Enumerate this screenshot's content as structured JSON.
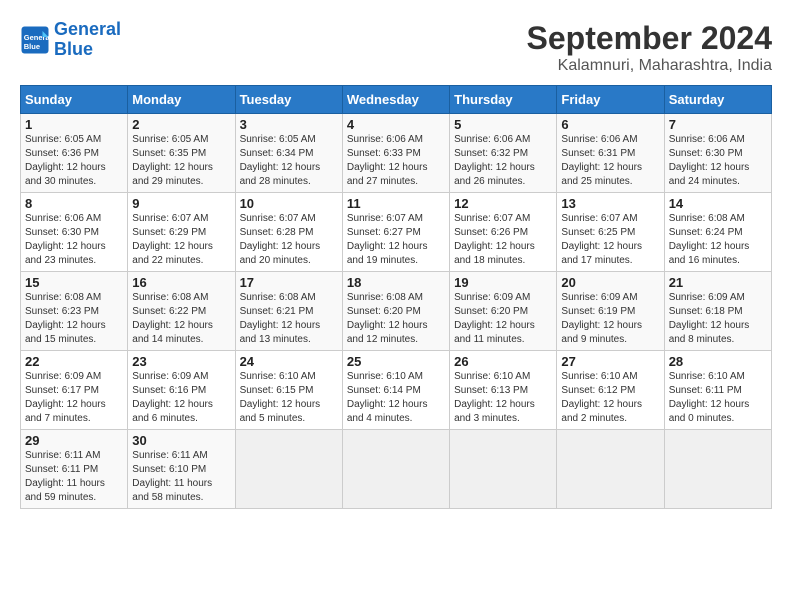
{
  "header": {
    "logo_line1": "General",
    "logo_line2": "Blue",
    "title": "September 2024",
    "subtitle": "Kalamnuri, Maharashtra, India"
  },
  "weekdays": [
    "Sunday",
    "Monday",
    "Tuesday",
    "Wednesday",
    "Thursday",
    "Friday",
    "Saturday"
  ],
  "weeks": [
    [
      {
        "day": "1",
        "info": "Sunrise: 6:05 AM\nSunset: 6:36 PM\nDaylight: 12 hours\nand 30 minutes."
      },
      {
        "day": "2",
        "info": "Sunrise: 6:05 AM\nSunset: 6:35 PM\nDaylight: 12 hours\nand 29 minutes."
      },
      {
        "day": "3",
        "info": "Sunrise: 6:05 AM\nSunset: 6:34 PM\nDaylight: 12 hours\nand 28 minutes."
      },
      {
        "day": "4",
        "info": "Sunrise: 6:06 AM\nSunset: 6:33 PM\nDaylight: 12 hours\nand 27 minutes."
      },
      {
        "day": "5",
        "info": "Sunrise: 6:06 AM\nSunset: 6:32 PM\nDaylight: 12 hours\nand 26 minutes."
      },
      {
        "day": "6",
        "info": "Sunrise: 6:06 AM\nSunset: 6:31 PM\nDaylight: 12 hours\nand 25 minutes."
      },
      {
        "day": "7",
        "info": "Sunrise: 6:06 AM\nSunset: 6:30 PM\nDaylight: 12 hours\nand 24 minutes."
      }
    ],
    [
      {
        "day": "8",
        "info": "Sunrise: 6:06 AM\nSunset: 6:30 PM\nDaylight: 12 hours\nand 23 minutes."
      },
      {
        "day": "9",
        "info": "Sunrise: 6:07 AM\nSunset: 6:29 PM\nDaylight: 12 hours\nand 22 minutes."
      },
      {
        "day": "10",
        "info": "Sunrise: 6:07 AM\nSunset: 6:28 PM\nDaylight: 12 hours\nand 20 minutes."
      },
      {
        "day": "11",
        "info": "Sunrise: 6:07 AM\nSunset: 6:27 PM\nDaylight: 12 hours\nand 19 minutes."
      },
      {
        "day": "12",
        "info": "Sunrise: 6:07 AM\nSunset: 6:26 PM\nDaylight: 12 hours\nand 18 minutes."
      },
      {
        "day": "13",
        "info": "Sunrise: 6:07 AM\nSunset: 6:25 PM\nDaylight: 12 hours\nand 17 minutes."
      },
      {
        "day": "14",
        "info": "Sunrise: 6:08 AM\nSunset: 6:24 PM\nDaylight: 12 hours\nand 16 minutes."
      }
    ],
    [
      {
        "day": "15",
        "info": "Sunrise: 6:08 AM\nSunset: 6:23 PM\nDaylight: 12 hours\nand 15 minutes."
      },
      {
        "day": "16",
        "info": "Sunrise: 6:08 AM\nSunset: 6:22 PM\nDaylight: 12 hours\nand 14 minutes."
      },
      {
        "day": "17",
        "info": "Sunrise: 6:08 AM\nSunset: 6:21 PM\nDaylight: 12 hours\nand 13 minutes."
      },
      {
        "day": "18",
        "info": "Sunrise: 6:08 AM\nSunset: 6:20 PM\nDaylight: 12 hours\nand 12 minutes."
      },
      {
        "day": "19",
        "info": "Sunrise: 6:09 AM\nSunset: 6:20 PM\nDaylight: 12 hours\nand 11 minutes."
      },
      {
        "day": "20",
        "info": "Sunrise: 6:09 AM\nSunset: 6:19 PM\nDaylight: 12 hours\nand 9 minutes."
      },
      {
        "day": "21",
        "info": "Sunrise: 6:09 AM\nSunset: 6:18 PM\nDaylight: 12 hours\nand 8 minutes."
      }
    ],
    [
      {
        "day": "22",
        "info": "Sunrise: 6:09 AM\nSunset: 6:17 PM\nDaylight: 12 hours\nand 7 minutes."
      },
      {
        "day": "23",
        "info": "Sunrise: 6:09 AM\nSunset: 6:16 PM\nDaylight: 12 hours\nand 6 minutes."
      },
      {
        "day": "24",
        "info": "Sunrise: 6:10 AM\nSunset: 6:15 PM\nDaylight: 12 hours\nand 5 minutes."
      },
      {
        "day": "25",
        "info": "Sunrise: 6:10 AM\nSunset: 6:14 PM\nDaylight: 12 hours\nand 4 minutes."
      },
      {
        "day": "26",
        "info": "Sunrise: 6:10 AM\nSunset: 6:13 PM\nDaylight: 12 hours\nand 3 minutes."
      },
      {
        "day": "27",
        "info": "Sunrise: 6:10 AM\nSunset: 6:12 PM\nDaylight: 12 hours\nand 2 minutes."
      },
      {
        "day": "28",
        "info": "Sunrise: 6:10 AM\nSunset: 6:11 PM\nDaylight: 12 hours\nand 0 minutes."
      }
    ],
    [
      {
        "day": "29",
        "info": "Sunrise: 6:11 AM\nSunset: 6:11 PM\nDaylight: 11 hours\nand 59 minutes."
      },
      {
        "day": "30",
        "info": "Sunrise: 6:11 AM\nSunset: 6:10 PM\nDaylight: 11 hours\nand 58 minutes."
      },
      {
        "day": "",
        "info": ""
      },
      {
        "day": "",
        "info": ""
      },
      {
        "day": "",
        "info": ""
      },
      {
        "day": "",
        "info": ""
      },
      {
        "day": "",
        "info": ""
      }
    ]
  ]
}
